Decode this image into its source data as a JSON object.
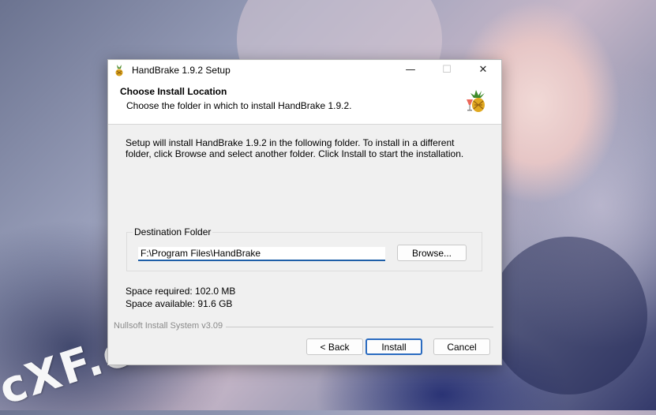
{
  "watermark": "cXF.co",
  "window": {
    "title": "HandBrake 1.9.2 Setup",
    "controls": {
      "minimize": "—",
      "maximize": "☐",
      "close": "✕"
    }
  },
  "header": {
    "title": "Choose Install Location",
    "subtitle": "Choose the folder in which to install HandBrake 1.9.2.",
    "logo_icon": "handbrake-pineapple-icon"
  },
  "body": {
    "instructions": "Setup will install HandBrake 1.9.2 in the following folder. To install in a different folder, click Browse and select another folder. Click Install to start the installation."
  },
  "destination": {
    "group_label": "Destination Folder",
    "path": "F:\\Program Files\\HandBrake",
    "browse_label": "Browse..."
  },
  "space": {
    "required": "Space required: 102.0 MB",
    "available": "Space available: 91.6 GB"
  },
  "footer": {
    "branding": "Nullsoft Install System v3.09",
    "back_label": "< Back",
    "install_label": "Install",
    "cancel_label": "Cancel"
  },
  "colors": {
    "accent": "#2a6bc0",
    "window_bg": "#f0f0f0"
  }
}
